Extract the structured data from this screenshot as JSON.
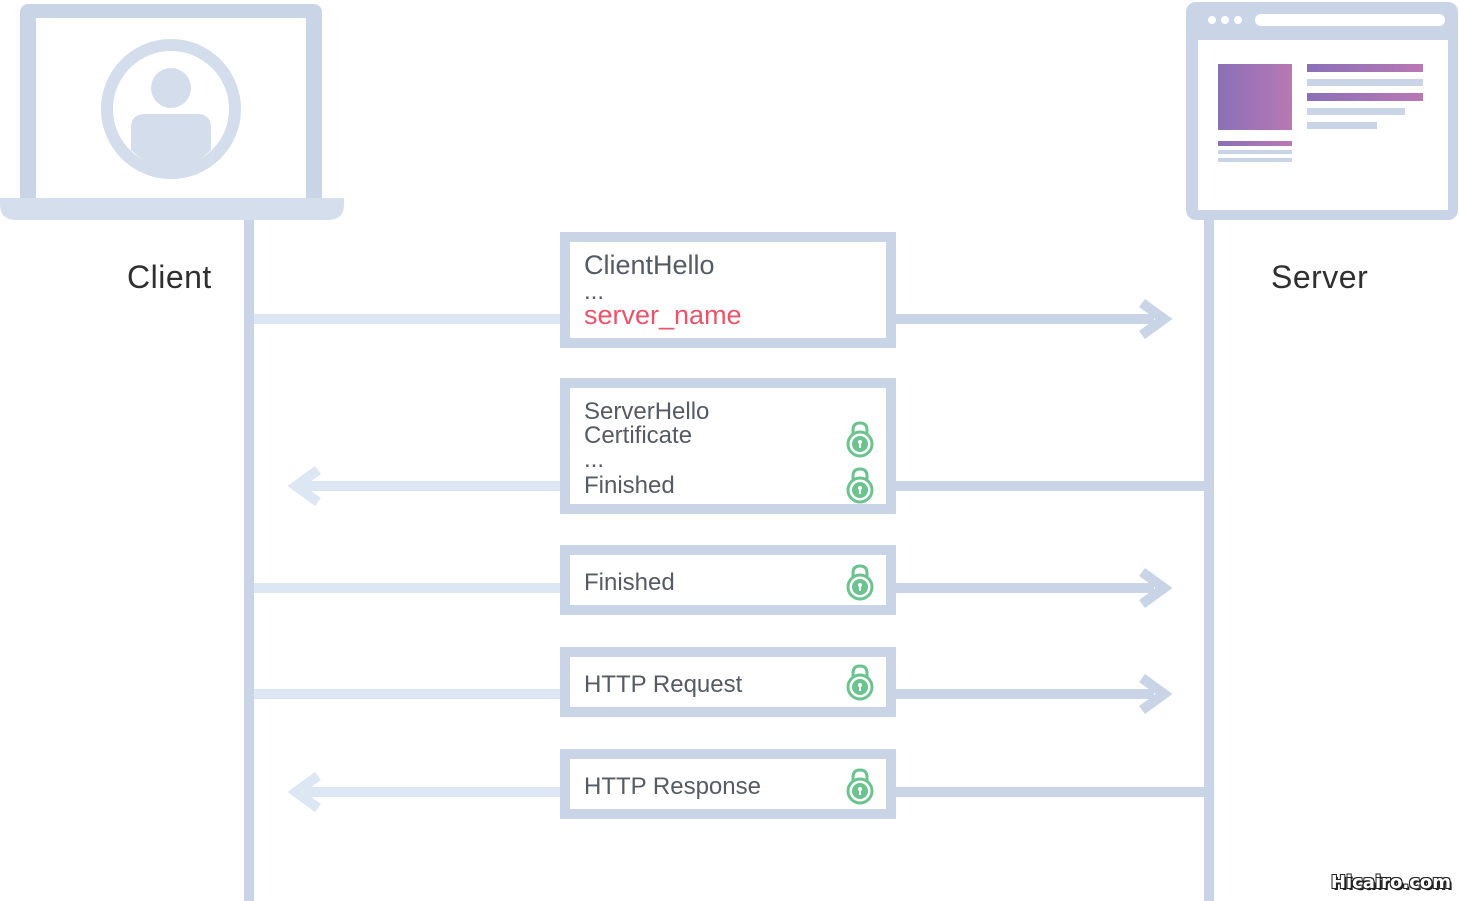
{
  "participants": {
    "client_label": "Client",
    "server_label": "Server"
  },
  "messages": [
    {
      "id": "client-hello",
      "direction": "client-to-server",
      "lines": [
        {
          "text": "ClientHello",
          "style": "big"
        },
        {
          "text": "...",
          "style": "normal"
        },
        {
          "text": "server_name",
          "style": "accent"
        }
      ],
      "locks": []
    },
    {
      "id": "server-hello",
      "direction": "server-to-client",
      "lines": [
        {
          "text": "ServerHello",
          "style": "normal"
        },
        {
          "text": "Certificate",
          "style": "normal"
        },
        {
          "text": "...",
          "style": "normal"
        },
        {
          "text": "Finished",
          "style": "normal"
        }
      ],
      "locks": [
        "Certificate",
        "Finished"
      ]
    },
    {
      "id": "client-finished",
      "direction": "client-to-server",
      "lines": [
        {
          "text": "Finished",
          "style": "normal"
        }
      ],
      "locks": [
        "Finished"
      ]
    },
    {
      "id": "http-request",
      "direction": "client-to-server",
      "lines": [
        {
          "text": "HTTP Request",
          "style": "normal"
        }
      ],
      "locks": [
        "HTTP Request"
      ]
    },
    {
      "id": "http-response",
      "direction": "server-to-client",
      "lines": [
        {
          "text": "HTTP Response",
          "style": "normal"
        }
      ],
      "locks": [
        "HTTP Response"
      ]
    }
  ],
  "icons": {
    "client": "laptop-user-icon",
    "server": "browser-window-icon",
    "lock": "lock-icon"
  },
  "colors": {
    "lane": "#c9d4e6",
    "lane_light": "#dde6f3",
    "accent": "#e8556b",
    "lock": "#6cc38f",
    "gradient_start": "#8a70b8",
    "gradient_end": "#b878b4"
  },
  "watermark": "Hicairo.com"
}
